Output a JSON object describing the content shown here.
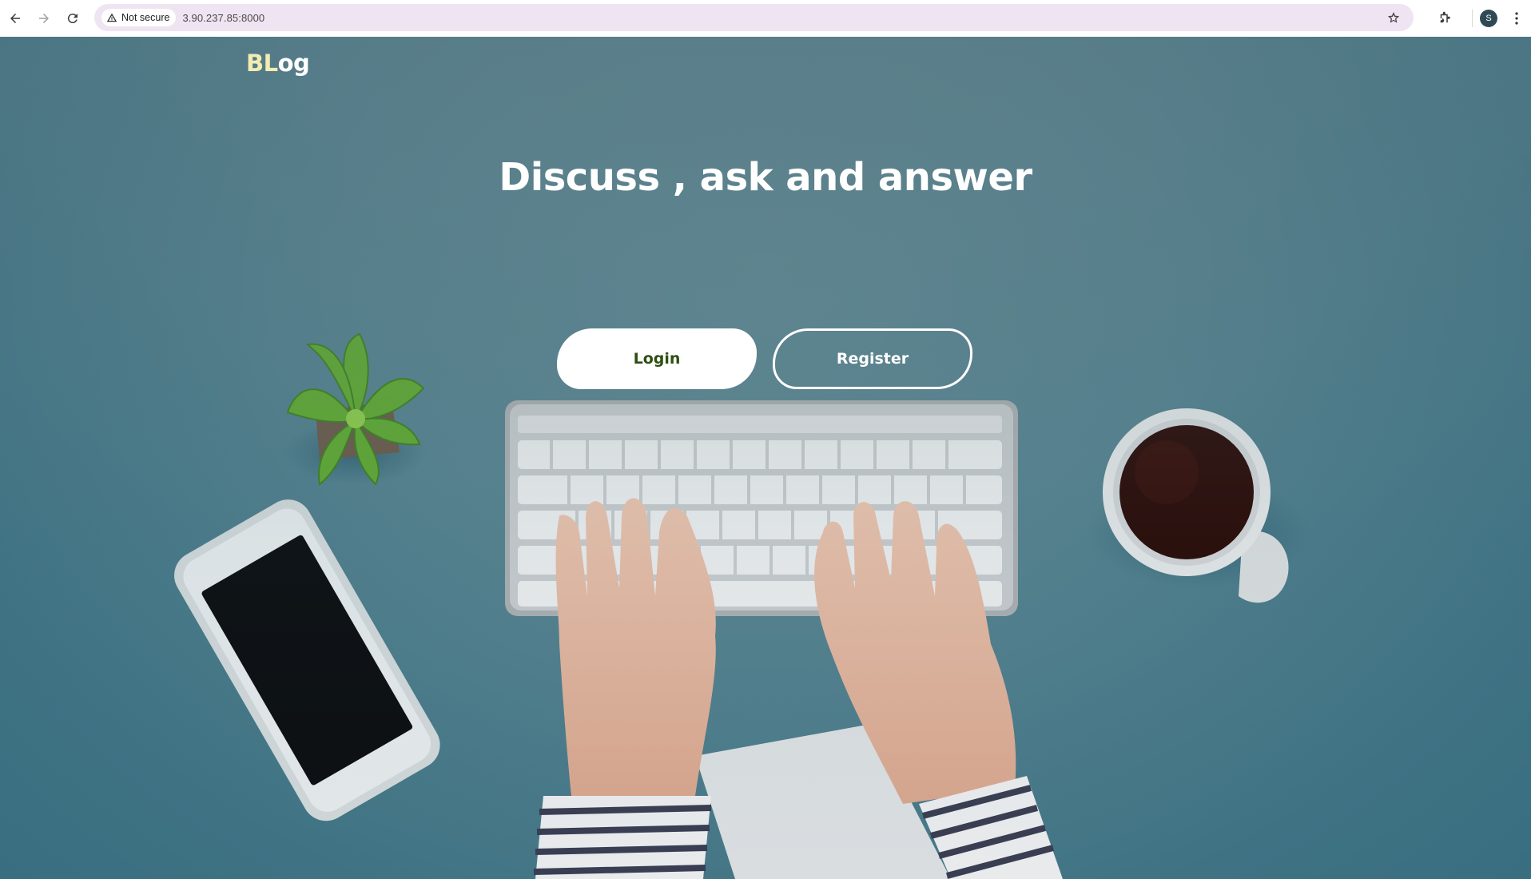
{
  "browser": {
    "security_label": "Not secure",
    "url": "3.90.237.85:8000",
    "profile_initial": "S"
  },
  "page": {
    "brand_part1": "BL",
    "brand_part2": "og",
    "headline": "Discuss , ask and answer",
    "login_label": "Login",
    "register_label": "Register"
  },
  "colors": {
    "background": "#4f7f8d",
    "brand_accent": "#f3ecb0",
    "login_text": "#2d4f12"
  },
  "icons": [
    "back-icon",
    "forward-icon",
    "reload-icon",
    "warning-icon",
    "star-icon",
    "extensions-icon",
    "kebab-menu-icon"
  ]
}
